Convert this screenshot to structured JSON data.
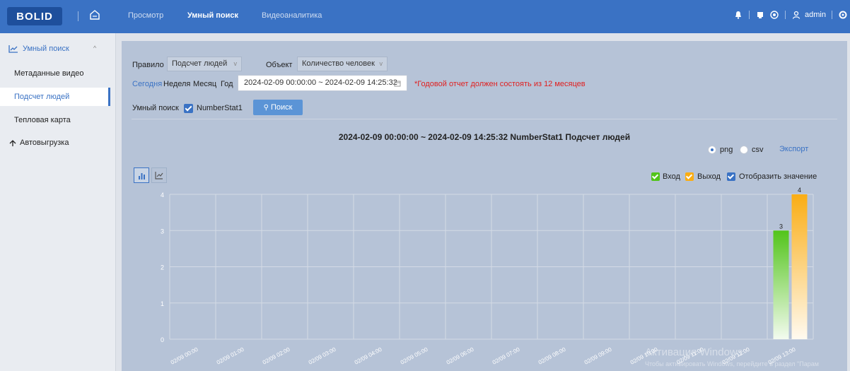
{
  "app": {
    "logo_text": "BOLID",
    "nav": [
      "Просмотр",
      "Умный поиск",
      "Видеоаналитика"
    ],
    "user": "admin"
  },
  "sidebar": {
    "header": "Умный поиск",
    "items": [
      "Метаданные видео",
      "Подсчет людей",
      "Тепловая карта"
    ],
    "autoupload": "Автовыгрузка"
  },
  "filters": {
    "rule_label": "Правило",
    "rule_value": "Подсчет людей",
    "object_label": "Объект",
    "object_value": "Количество человек",
    "periods": [
      "Сегодня",
      "Неделя",
      "Месяц",
      "Год"
    ],
    "date_range": "2024-02-09 00:00:00 ~ 2024-02-09 14:25:32",
    "warning": "*Годовой отчет должен состоять из 12 месяцев",
    "smart_label": "Умный поиск",
    "channel": "NumberStat1",
    "search_button": "Поиск"
  },
  "chart_header": {
    "title": "2024-02-09 00:00:00 ~ 2024-02-09 14:25:32  NumberStat1  Подсчет людей",
    "format_png": "png",
    "format_csv": "csv",
    "export": "Экспорт",
    "legend_in": "Вход",
    "legend_out": "Выход",
    "legend_values": "Отобразить значение"
  },
  "colors": {
    "accent": "#3a72c4",
    "in": "#52c41a",
    "out": "#faad14",
    "warning": "#e02020"
  },
  "chart_data": {
    "type": "bar",
    "categories": [
      "02/09 00:00",
      "02/09 01:00",
      "02/09 02:00",
      "02/09 03:00",
      "02/09 04:00",
      "02/09 05:00",
      "02/09 06:00",
      "02/09 07:00",
      "02/09 08:00",
      "02/09 09:00",
      "02/09 10:00",
      "02/09 11:00",
      "02/09 12:00",
      "02/09 13:00"
    ],
    "series": [
      {
        "name": "Вход",
        "values": [
          0,
          0,
          0,
          0,
          0,
          0,
          0,
          0,
          0,
          0,
          0,
          0,
          0,
          3
        ]
      },
      {
        "name": "Выход",
        "values": [
          0,
          0,
          0,
          0,
          0,
          0,
          0,
          0,
          0,
          0,
          0,
          0,
          0,
          4
        ]
      }
    ],
    "ylim": [
      0,
      4
    ],
    "yticks": [
      0,
      1,
      2,
      3,
      4
    ],
    "show_values": true,
    "grid": true
  },
  "watermark": {
    "line1": "Активация Windows",
    "line2": "Чтобы активировать Windows, перейдите в раздел \"Парам"
  }
}
